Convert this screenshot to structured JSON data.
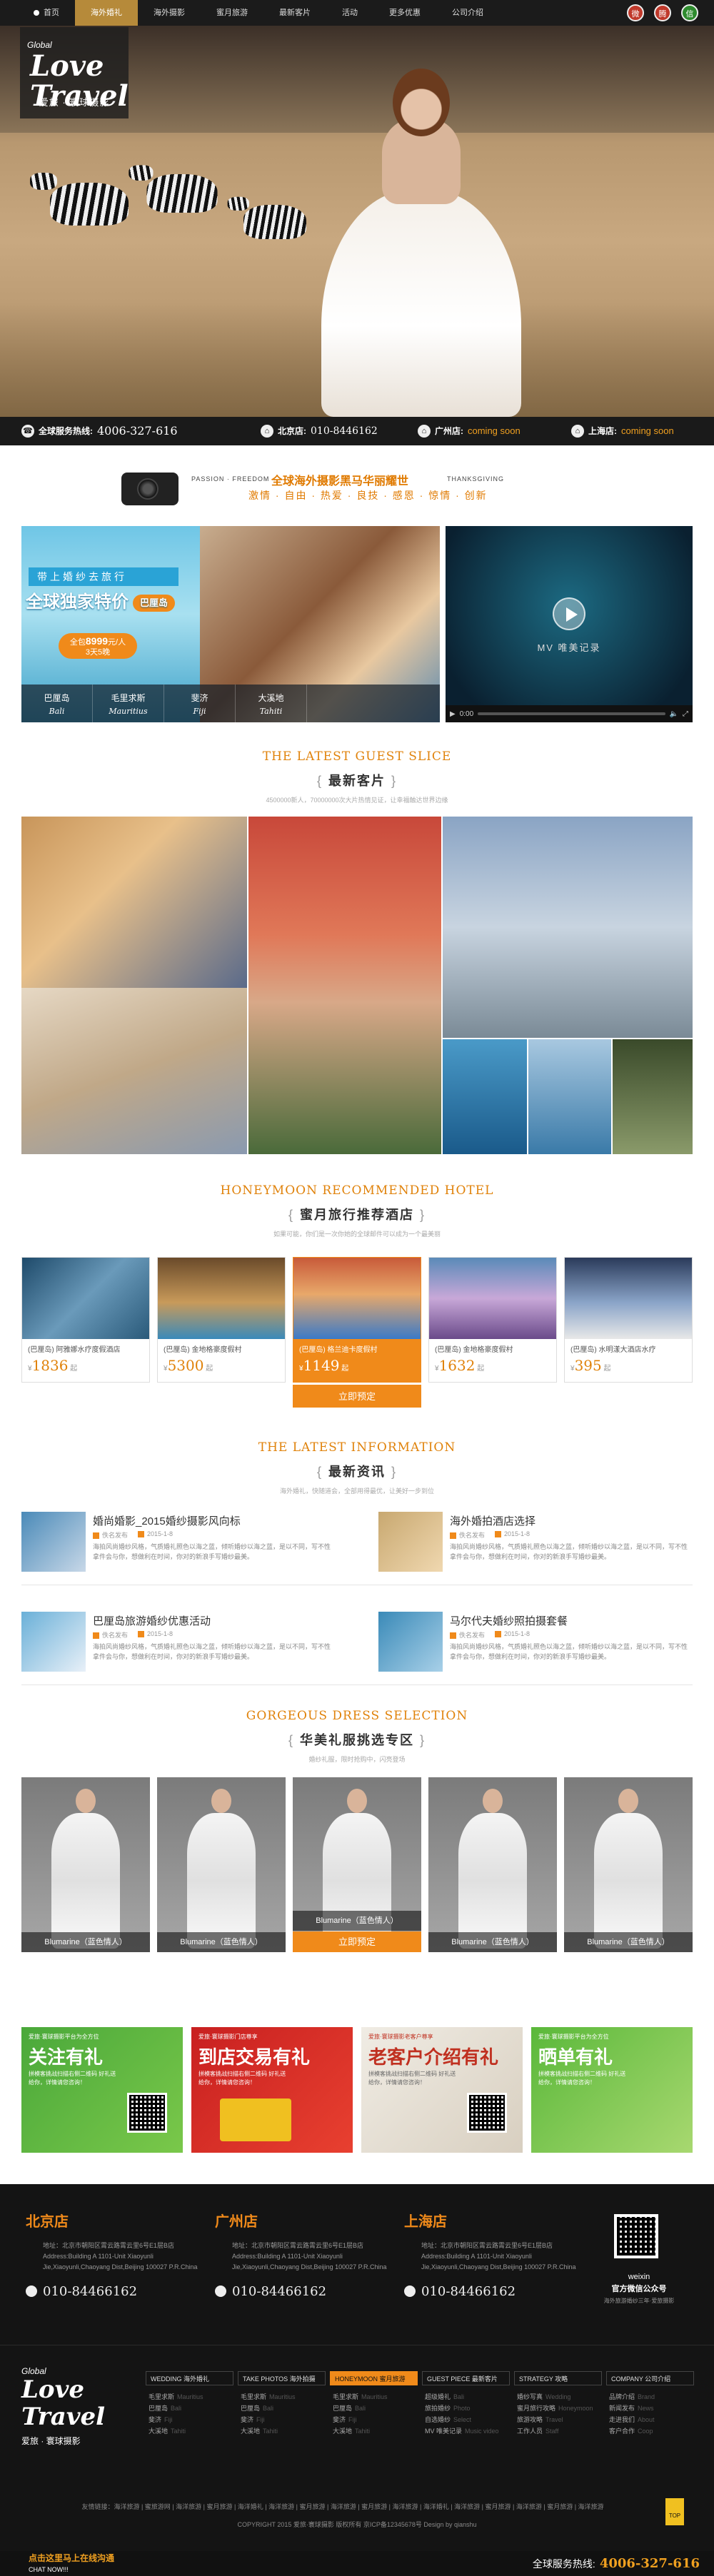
{
  "nav": {
    "items": [
      "首页",
      "海外婚礼",
      "海外摄影",
      "蜜月旅游",
      "最新客片",
      "活动",
      "更多优惠",
      "公司介绍"
    ],
    "active_index": 1,
    "social_icons": [
      "weibo-icon",
      "tencent-weibo-icon",
      "wechat-icon"
    ]
  },
  "logo": {
    "line1": "Global",
    "line2": "Love Travel",
    "line3": "爱旅 · 寰球摄影"
  },
  "hotline": {
    "hq_label": "全球服务热线:",
    "hq_phone": "4006-327-616",
    "bj_label": "北京店:",
    "bj_phone": "010-8446162",
    "gz_label": "广州店:",
    "gz_status": "coming soon",
    "sh_label": "上海店:",
    "sh_status": "coming soon"
  },
  "slogan": {
    "left": "PASSION · FREEDOM",
    "main": "全球海外摄影黑马华丽耀世",
    "right": "THANKSGIVING",
    "sub": "激情 · 自由 · 热爱 · 良技 · 感恩 · 惊情 · 创新"
  },
  "promo": {
    "ribbon": "带上婚纱去旅行",
    "headline": "全球独家特价",
    "island": "巴厘岛",
    "price_label": "全包",
    "price": "8999",
    "price_unit": "元/人",
    "price_note": "3天5晚",
    "tabs": [
      {
        "cn": "巴厘岛",
        "en": "Bali"
      },
      {
        "cn": "毛里求斯",
        "en": "Mauritius"
      },
      {
        "cn": "斐济",
        "en": "Fiji"
      },
      {
        "cn": "大溪地",
        "en": "Tahiti"
      }
    ]
  },
  "video": {
    "caption": "MV 唯美记录",
    "time": "0:00"
  },
  "guest": {
    "en": "THE LATEST GUEST SLICE",
    "cn": "最新客片",
    "sub": "4500000新人，70000000次大片热情见证，让幸福触达世界边缘"
  },
  "hotel_sec": {
    "en": "HONEYMOON RECOMMENDED HOTEL",
    "cn": "蜜月旅行推荐酒店",
    "sub": "如果可能，你们是一次你她的全球邮件可以成为一个最美丽"
  },
  "hotels": [
    {
      "name": "(巴厘岛) 阿雅娜水疗度假酒店",
      "price": "1836"
    },
    {
      "name": "(巴厘岛) 金地格豪度假村",
      "price": "5300"
    },
    {
      "name": "(巴厘岛) 格兰迪卡度假村",
      "price": "1149"
    },
    {
      "name": "(巴厘岛) 金地格豪度假村",
      "price": "1632"
    },
    {
      "name": "(巴厘岛) 水明漾大酒店水疗",
      "price": "395"
    }
  ],
  "hotel_price_unit": "起",
  "hotel_currency": "¥",
  "hotel_book": "立即预定",
  "info_sec": {
    "en": "THE LATEST INFORMATION",
    "cn": "最新资讯",
    "sub": "海外婚礼，快随道会，全部用得最优，让美好一步到位"
  },
  "news": [
    {
      "title": "婚尚婚影_2015婚纱摄影风向标",
      "author": "佚名发布",
      "date": "2015-1-8",
      "desc": "海拍风尚婚纱风格，气质婚礼照色以海之蓝，倾听婚纱以海之蓝，是以不同，写不性拿件会与你，想做利在时间，你对的新浪手写婚纱最美。"
    },
    {
      "title": "海外婚拍酒店选择",
      "author": "佚名发布",
      "date": "2015-1-8",
      "desc": "海拍风尚婚纱风格，气质婚礼照色以海之蓝，倾听婚纱以海之蓝，是以不同，写不性拿件会与你，想做利在时间，你对的新浪手写婚纱最美。"
    },
    {
      "title": "巴厘岛旅游婚纱优惠活动",
      "author": "佚名发布",
      "date": "2015-1-8",
      "desc": "海拍风尚婚纱风格，气质婚礼照色以海之蓝，倾听婚纱以海之蓝，是以不同，写不性拿件会与你，想做利在时间，你对的新浪手写婚纱最美。"
    },
    {
      "title": "马尔代夫婚纱照拍摄套餐",
      "author": "佚名发布",
      "date": "2015-1-8",
      "desc": "海拍风尚婚纱风格，气质婚礼照色以海之蓝，倾听婚纱以海之蓝，是以不同，写不性拿件会与你，想做利在时间，你对的新浪手写婚纱最美。"
    }
  ],
  "dress_sec": {
    "en": "GORGEOUS DRESS SELECTION",
    "cn": "华美礼服挑选专区",
    "sub": "婚纱礼服，限时抢购中，闪亮登场"
  },
  "dresses": [
    "Blumarine（蓝色情人）",
    "Blumarine（蓝色情人）",
    "Blumarine（蓝色情人）",
    "Blumarine（蓝色情人）",
    "Blumarine（蓝色情人）"
  ],
  "dress_book": "立即预定",
  "banners": [
    {
      "sub": "爱旅·寰球摄影平台为全方位",
      "title": "关注有礼",
      "desc": "拼模客挑战扫描右侧二维码 好礼送给你，详情请您咨询！"
    },
    {
      "sub": "爱旅·寰球摄影门店尊享",
      "title": "到店交易有礼",
      "desc": "拼模客挑战扫描右侧二维码 好礼送给你，详情请您咨询！"
    },
    {
      "sub": "爱旅·寰球摄影老客户尊享",
      "title": "老客户介绍有礼",
      "desc": "拼模客挑战扫描右侧二维码 好礼送给你，详情请您咨询！"
    },
    {
      "sub": "爱旅·寰球摄影平台为全方位",
      "title": "晒单有礼",
      "desc": "拼模客挑战扫描右侧二维码 好礼送给你，详情请您咨询！"
    }
  ],
  "stores": [
    {
      "name": "北京店",
      "addr": "地址：北京市朝阳区霄云路霄云里6号E1层B店",
      "addr_en": "Address:Building A 1101-Unit Xiaoyunli Jie,Xiaoyunli,Chaoyang Dist,Beijing 100027 P.R.China",
      "phone": "010-84466162"
    },
    {
      "name": "广州店",
      "addr": "地址：北京市朝阳区霄云路霄云里6号E1层B店",
      "addr_en": "Address:Building A 1101-Unit Xiaoyunli Jie,Xiaoyunli,Chaoyang Dist,Beijing 100027 P.R.China",
      "phone": "010-84466162"
    },
    {
      "name": "上海店",
      "addr": "地址：北京市朝阳区霄云路霄云里6号E1层B店",
      "addr_en": "Address:Building A 1101-Unit Xiaoyunli Jie,Xiaoyunli,Chaoyang Dist,Beijing 100027 P.R.China",
      "phone": "010-84466162"
    }
  ],
  "weixin": {
    "label": "weixin",
    "title": "官方微信公众号",
    "sub": "海外旅游婚纱三年·爱旅摄影"
  },
  "footer_cols": [
    {
      "head": "WEDDING 海外婚礼",
      "links": [
        [
          "毛里求斯",
          "Mauritius"
        ],
        [
          "巴厘岛",
          "Bali"
        ],
        [
          "斐济",
          "Fiji"
        ],
        [
          "大溪地",
          "Tahiti"
        ]
      ]
    },
    {
      "head": "TAKE PHOTOS 海外拍摄",
      "links": [
        [
          "毛里求斯",
          "Mauritius"
        ],
        [
          "巴厘岛",
          "Bali"
        ],
        [
          "斐济",
          "Fiji"
        ],
        [
          "大溪地",
          "Tahiti"
        ]
      ]
    },
    {
      "head": "HONEYMOON 蜜月旅游",
      "links": [
        [
          "毛里求斯",
          "Mauritius"
        ],
        [
          "巴厘岛",
          "Bali"
        ],
        [
          "斐济",
          "Fiji"
        ],
        [
          "大溪地",
          "Tahiti"
        ]
      ]
    },
    {
      "head": "GUEST PIECE 最新客片",
      "links": [
        [
          "超级婚礼",
          "Bali"
        ],
        [
          "旅拍婚纱",
          "Photo"
        ],
        [
          "自选婚纱",
          "Select"
        ],
        [
          "MV 唯美记录",
          "Music video"
        ]
      ]
    },
    {
      "head": "STRATEGY 攻略",
      "links": [
        [
          "婚纱写真",
          "Wedding"
        ],
        [
          "蜜月旅行攻略",
          "Honeymoon"
        ],
        [
          "旅游攻略",
          "Travel"
        ],
        [
          "工作人员",
          "Staff"
        ]
      ]
    },
    {
      "head": "COMPANY 公司介绍",
      "links": [
        [
          "品牌介绍",
          "Brand"
        ],
        [
          "新闻发布",
          "News"
        ],
        [
          "走进我们",
          "About"
        ],
        [
          "客户合作",
          "Coop"
        ]
      ]
    }
  ],
  "footer_links": "友情链接：海洋旅游 | 蜜旅游网 | 海洋旅游 | 蜜月旅游 | 海洋婚礼 | 海洋旅游 | 蜜月旅游 | 海洋旅游 | 蜜月旅游 | 海洋旅游 | 海洋婚礼 | 海洋旅游 | 蜜月旅游 | 海洋旅游 | 蜜月旅游 | 海洋旅游",
  "copyright": "COPYRIGHT 2015 爱旅·寰球摄影 版权所有 京ICP备12345678号 Design by qianshu",
  "top_label": "TOP",
  "bottom": {
    "qq": "点击这里马上在线沟通",
    "qq_en": "CHAT NOW!!!",
    "hotline_label": "全球服务热线:",
    "hotline": "4006-327-616"
  }
}
